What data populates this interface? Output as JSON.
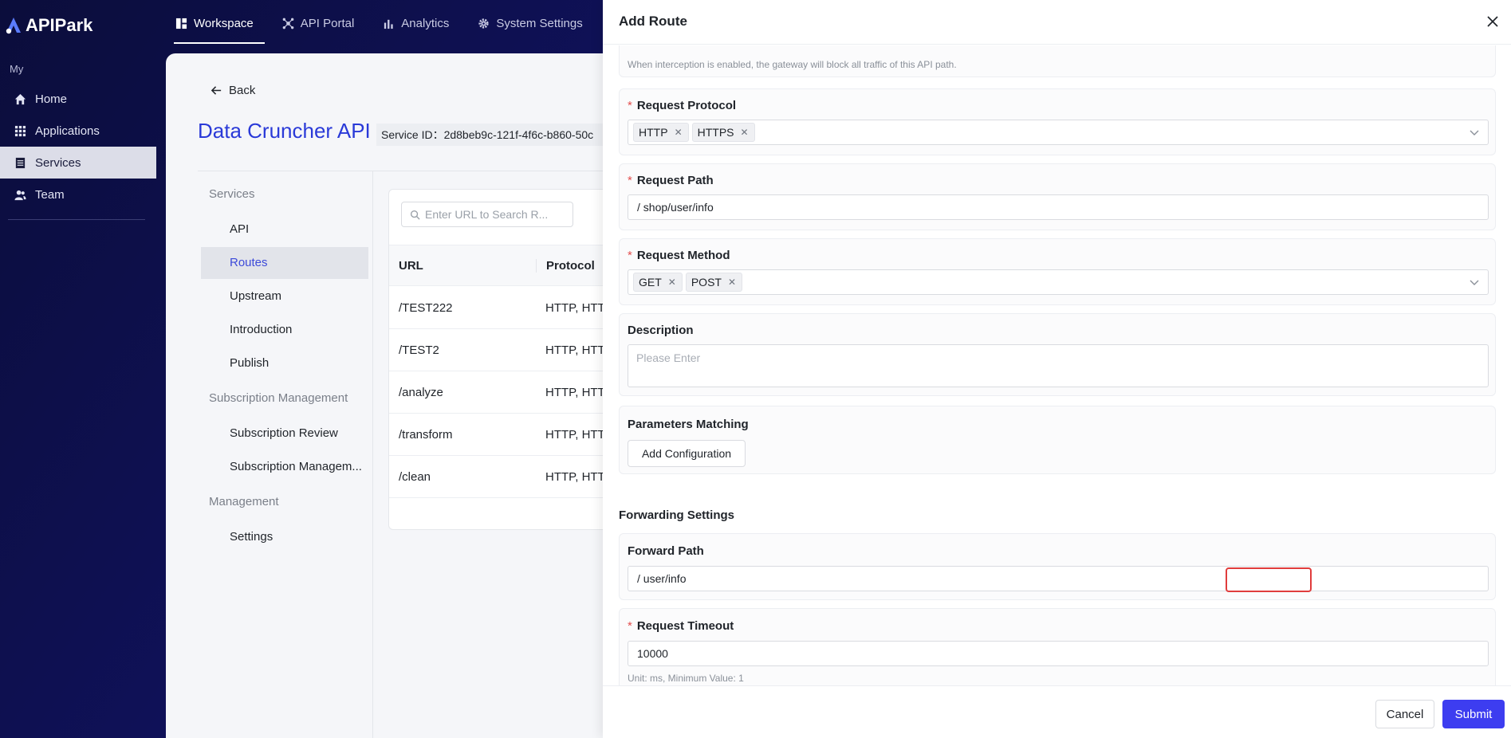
{
  "app": {
    "brand": "APIPark"
  },
  "topnav": [
    {
      "label": "Workspace",
      "active": true,
      "icon": "dashboard-icon"
    },
    {
      "label": "API Portal",
      "active": false,
      "icon": "portal-icon"
    },
    {
      "label": "Analytics",
      "active": false,
      "icon": "bar-chart-icon"
    },
    {
      "label": "System Settings",
      "active": false,
      "icon": "gear-icon"
    }
  ],
  "sidebar": {
    "section": "My",
    "items": [
      {
        "label": "Home",
        "icon": "home-icon"
      },
      {
        "label": "Applications",
        "icon": "grid-icon"
      },
      {
        "label": "Services",
        "icon": "services-icon",
        "active": true
      },
      {
        "label": "Team",
        "icon": "team-icon"
      }
    ]
  },
  "page": {
    "back": "Back",
    "service_title": "Data Cruncher API",
    "service_id": "Service ID：2d8beb9c-121f-4f6c-b860-50c"
  },
  "subnav": {
    "groups": [
      {
        "title": "Services",
        "links": [
          "API",
          "Routes",
          "Upstream",
          "Introduction",
          "Publish"
        ]
      },
      {
        "title": "Subscription Management",
        "links": [
          "Subscription Review",
          "Subscription Managem..."
        ]
      },
      {
        "title": "Management",
        "links": [
          "Settings"
        ]
      }
    ],
    "active": "Routes"
  },
  "routes": {
    "search_placeholder": "Enter URL to Search R...",
    "columns": [
      "URL",
      "Protocol"
    ],
    "rows": [
      {
        "url": "/TEST222",
        "protocol": "HTTP, HTT"
      },
      {
        "url": "/TEST2",
        "protocol": "HTTP, HTT"
      },
      {
        "url": "/analyze",
        "protocol": "HTTP, HTT"
      },
      {
        "url": "/transform",
        "protocol": "HTTP, HTT"
      },
      {
        "url": "/clean",
        "protocol": "HTTP, HTT"
      }
    ]
  },
  "drawer": {
    "title": "Add Route",
    "intercept_hint": "When interception is enabled, the gateway will block all traffic of this API path.",
    "request_protocol": {
      "label": "Request Protocol",
      "tags": [
        "HTTP",
        "HTTPS"
      ]
    },
    "request_path": {
      "label": "Request Path",
      "value": "/ shop/user/info"
    },
    "request_method": {
      "label": "Request Method",
      "tags": [
        "GET",
        "POST"
      ]
    },
    "description": {
      "label": "Description",
      "placeholder": "Please Enter"
    },
    "params": {
      "label": "Parameters Matching",
      "button": "Add Configuration"
    },
    "forwarding_section": "Forwarding Settings",
    "forward_path": {
      "label": "Forward Path",
      "value": "/ user/info"
    },
    "request_timeout": {
      "label": "Request Timeout",
      "value": "10000",
      "hint": "Unit: ms, Minimum Value: 1"
    },
    "required_mark": "*",
    "tag_close": "✕",
    "cancel": "Cancel",
    "submit": "Submit"
  },
  "colors": {
    "accent": "#3d3df0",
    "highlight": "#e03c3c",
    "nav_bg": "#10125e",
    "title_blue": "#2a3ad8"
  }
}
